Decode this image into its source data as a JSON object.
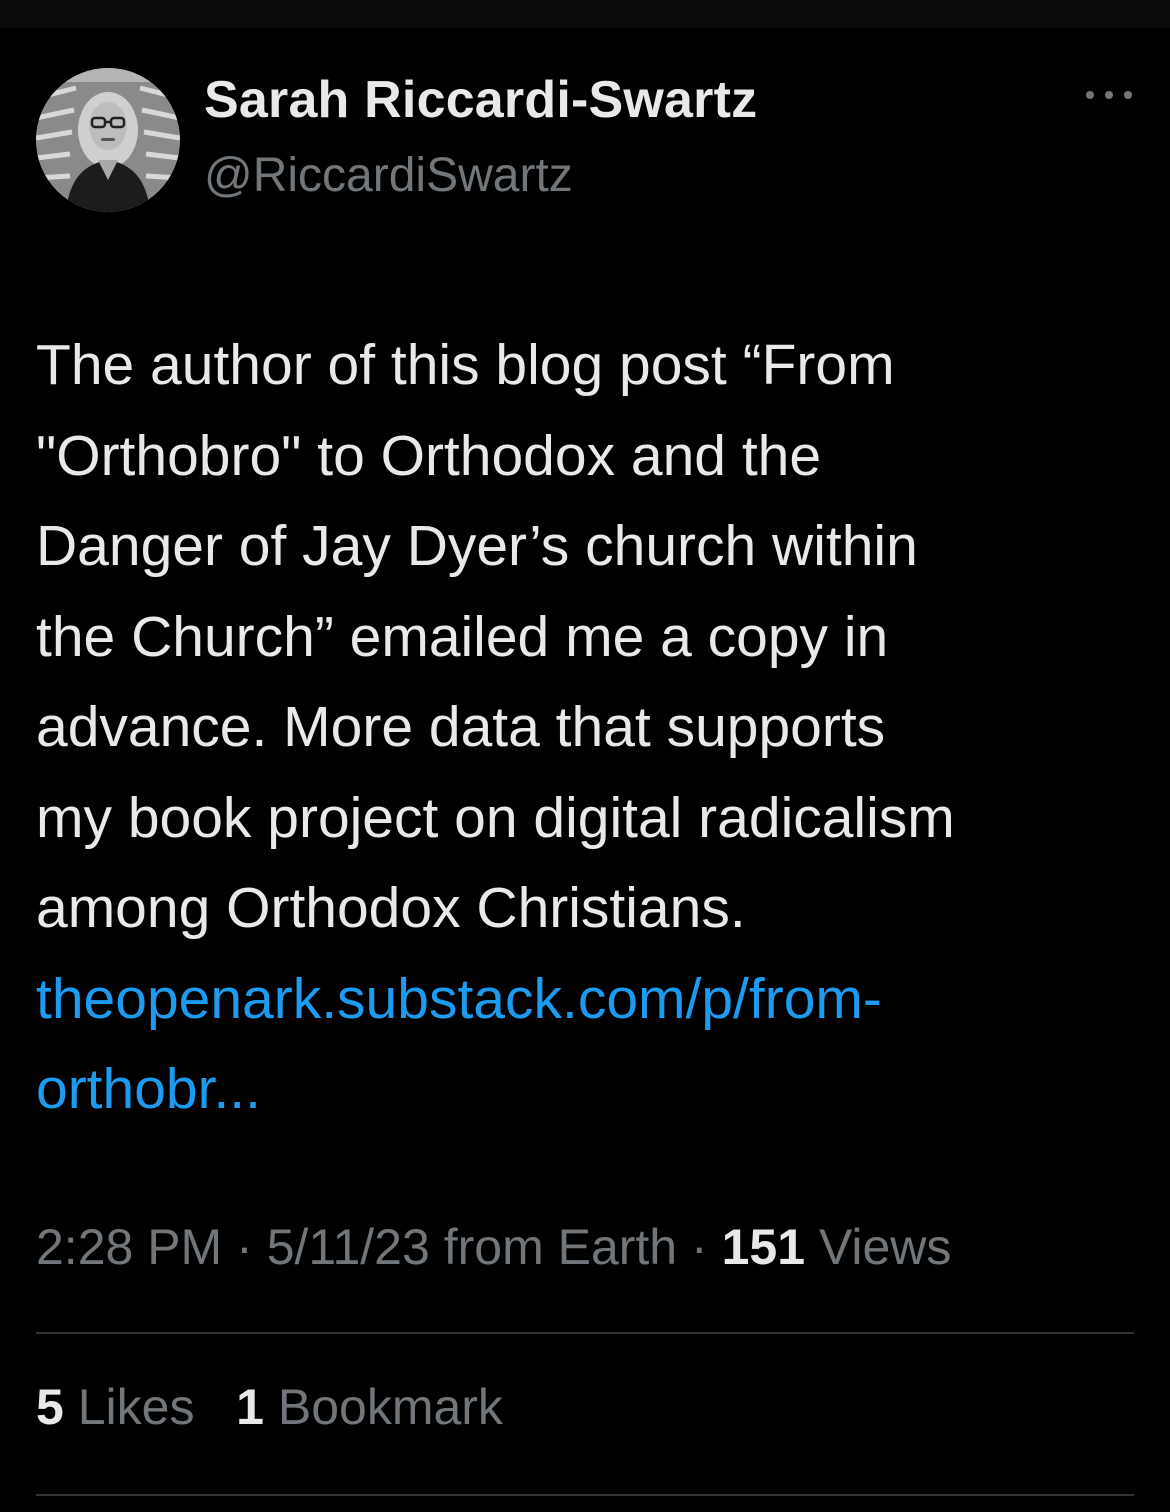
{
  "author": {
    "display_name": "Sarah Riccardi-Swartz",
    "handle": "@RiccardiSwartz",
    "avatar_icon": "profile-photo"
  },
  "tweet": {
    "lines": [
      "The author of this blog post “From",
      "\"Orthobro\" to Orthodox and the",
      "Danger of Jay Dyer’s church within",
      "the Church” emailed me a copy in",
      "advance. More data that supports",
      "my book project on digital radicalism",
      "among Orthodox Christians."
    ],
    "link_lines": [
      "theopenark.substack.com/p/from-",
      "orthobr..."
    ]
  },
  "meta": {
    "time": "2:28 PM",
    "sep1": "·",
    "date": "5/11/23",
    "source": "from Earth",
    "sep2": "·",
    "views_count": "151",
    "views_label": "Views"
  },
  "stats": {
    "likes_count": "5",
    "likes_label": "Likes",
    "bookmarks_count": "1",
    "bookmarks_label": "Bookmark"
  },
  "colors": {
    "background": "#000000",
    "text_primary": "#e7e9ea",
    "text_secondary": "#71767b",
    "link": "#1d9bf0",
    "divider": "#2f3336"
  },
  "icons": {
    "more": "more-options-icon"
  }
}
